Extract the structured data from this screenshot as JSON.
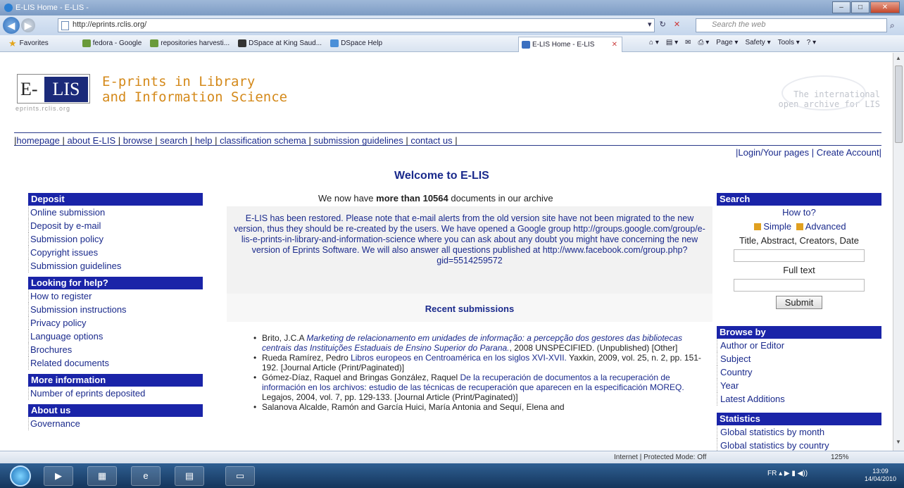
{
  "window": {
    "title": "E-LIS Home - E-LIS -",
    "url": "http://eprints.rclis.org/",
    "search_placeholder": "Search the web"
  },
  "favorites": {
    "label": "Favorites",
    "items": [
      "fedora - Google",
      "repositories harvesti...",
      "DSpace at King Saud...",
      "DSpace Help"
    ],
    "active_tab": "E-LIS Home - E-LIS"
  },
  "commandbar": [
    "Page ▾",
    "Safety ▾",
    "Tools ▾"
  ],
  "header": {
    "logo_e": "E-",
    "logo_lis": "LIS",
    "logo_sub": "eprints.rclis.org",
    "title_line1": "E-prints in Library",
    "title_line2": "and Information Science",
    "intl_line1": "The international",
    "intl_line2": "open archive for LIS"
  },
  "topnav": {
    "items": [
      "homepage",
      "about E-LIS",
      "browse",
      "search",
      "help",
      "classification schema",
      "submission guidelines",
      "contact us"
    ],
    "login": "|Login/Your pages | Create Account|"
  },
  "main": {
    "welcome": "Welcome to E-LIS",
    "docs_prefix": "We now have ",
    "docs_bold": "more than 10564",
    "docs_suffix": " documents in our archive",
    "notice": "E-LIS has been restored. Please note that e-mail alerts from the old version site have not been migrated to the new version, thus they should be re-created by the users. We have opened a Google group http://groups.google.com/group/e-lis-e-prints-in-library-and-information-science where you can ask about any doubt you might have concerning the new version of Eprints Software. We will also answer all questions published at http://www.facebook.com/group.php?gid=5514259572",
    "recent_title": "Recent submissions",
    "submissions": [
      {
        "author": "Brito, J.C.A ",
        "title": "Marketing de relacionamento em unidades de informação: a percepção dos gestores das bibliotecas centrais das Instituições Estaduais de Ensino Superior do Parana.",
        "rest": ", 2008 UNSPECIFIED. (Unpublished) [Other]"
      },
      {
        "author": "Rueda Ramírez, Pedro ",
        "title": "Libros europeos en Centroamérica en los siglos XVI-XVII.",
        "rest": " Yaxkin, 2009, vol. 25, n. 2, pp. 151-192. [Journal Article (Print/Paginated)]"
      },
      {
        "author": "Gómez-Díaz, Raquel and Bringas González, Raquel ",
        "title": "De la recuperación de documentos a la recuperación de información en los archivos: estudio de las técnicas de recuperación que aparecen en la especificación MOREQ.",
        "rest": " Legajos, 2004, vol. 7, pp. 129-133. [Journal Article (Print/Paginated)]"
      },
      {
        "author": "Salanova Alcalde, Ramón and García Huici, María Antonia and Sequí, Elena and",
        "title": "",
        "rest": ""
      }
    ]
  },
  "left_sidebar": [
    {
      "heading": "Deposit",
      "items": [
        "Online submission",
        "Deposit by e-mail",
        "Submission policy",
        "Copyright issues",
        "Submission guidelines"
      ]
    },
    {
      "heading": "Looking for help?",
      "items": [
        "How to register",
        "Submission instructions",
        "Privacy policy",
        "Language options",
        "Brochures",
        "Related documents"
      ]
    },
    {
      "heading": "More information",
      "items": [
        "Number of eprints deposited"
      ]
    },
    {
      "heading": "About us",
      "items": [
        "Governance"
      ]
    }
  ],
  "right_sidebar": {
    "search_heading": "Search",
    "how_to": "How to?",
    "simple": "Simple",
    "advanced": "Advanced",
    "field1_label": "Title, Abstract, Creators, Date",
    "field2_label": "Full text",
    "submit": "Submit",
    "browse_heading": "Browse by",
    "browse_items": [
      "Author or Editor",
      "Subject",
      "Country",
      "Year",
      "Latest Additions"
    ],
    "stats_heading": "Statistics",
    "stats_items": [
      "Global statistics by month",
      "Global statistics by country"
    ]
  },
  "statusbar": {
    "zone": "Internet | Protected Mode: Off",
    "zoom": "125%"
  },
  "taskbar": {
    "tray": "FR",
    "time": "13:09",
    "date": "14/04/2010"
  }
}
